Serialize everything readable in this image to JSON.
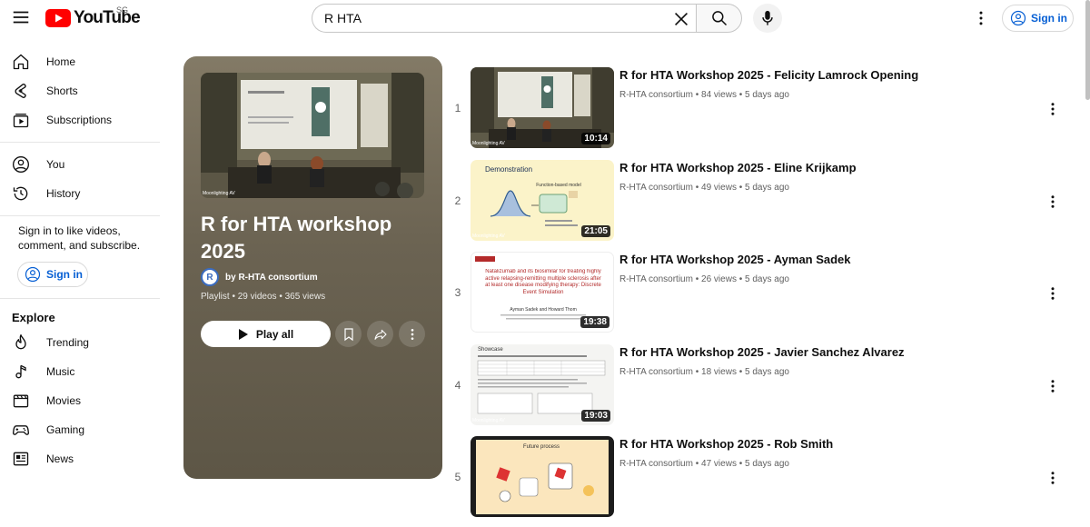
{
  "header": {
    "logo_text": "YouTube",
    "region": "SG",
    "search_value": "R HTA",
    "signin_label": "Sign in"
  },
  "sidebar": {
    "primary": [
      {
        "label": "Home",
        "icon": "home-icon"
      },
      {
        "label": "Shorts",
        "icon": "shorts-icon"
      },
      {
        "label": "Subscriptions",
        "icon": "subscriptions-icon"
      }
    ],
    "you": [
      {
        "label": "You",
        "icon": "account-icon"
      },
      {
        "label": "History",
        "icon": "history-icon"
      }
    ],
    "signin_prompt": "Sign in to like videos, comment, and subscribe.",
    "signin_label": "Sign in",
    "explore_title": "Explore",
    "explore": [
      {
        "label": "Trending",
        "icon": "trending-icon"
      },
      {
        "label": "Music",
        "icon": "music-icon"
      },
      {
        "label": "Movies",
        "icon": "movies-icon"
      },
      {
        "label": "Gaming",
        "icon": "gaming-icon"
      },
      {
        "label": "News",
        "icon": "news-icon"
      }
    ]
  },
  "playlist": {
    "title": "R for HTA workshop 2025",
    "owner": "by R-HTA consortium",
    "avatar_letter": "R",
    "meta": "Playlist • 29 videos • 365 views",
    "play_all_label": "Play all",
    "thumb_watermark": "Moonlighting AV"
  },
  "videos": [
    {
      "index": "1",
      "title": "R for HTA Workshop 2025 - Felicity Lamrock Opening",
      "channel": "R-HTA consortium",
      "views": "84 views",
      "age": "5 days ago",
      "duration": "10:14"
    },
    {
      "index": "2",
      "title": "R for HTA Workshop 2025 - Eline Krijkamp",
      "channel": "R-HTA consortium",
      "views": "49 views",
      "age": "5 days ago",
      "duration": "21:05",
      "slide_title": "Demonstration",
      "slide_label": "Function-based model"
    },
    {
      "index": "3",
      "title": "R for HTA Workshop 2025 - Ayman Sadek",
      "channel": "R-HTA consortium",
      "views": "26 views",
      "age": "5 days ago",
      "duration": "19:38",
      "slide_title": "Natalizumab and its biosimilar for treating highly active relapsing-remitting multiple sclerosis after at least one disease modifying therapy: Discrete Event Simulation",
      "slide_authors": "Ayman Sadek and Howard Thom"
    },
    {
      "index": "4",
      "title": "R for HTA Workshop 2025 - Javier Sanchez Alvarez",
      "channel": "R-HTA consortium",
      "views": "18 views",
      "age": "5 days ago",
      "duration": "19:03",
      "slide_title": "Showcase"
    },
    {
      "index": "5",
      "title": "R for HTA Workshop 2025 - Rob Smith",
      "channel": "R-HTA consortium",
      "views": "47 views",
      "age": "5 days ago",
      "duration": "",
      "slide_title": "Future process"
    }
  ],
  "separator": "•",
  "colors": {
    "brand_red": "#ff0000",
    "link_blue": "#065fd4",
    "playlist_bg": "#6b6352"
  }
}
